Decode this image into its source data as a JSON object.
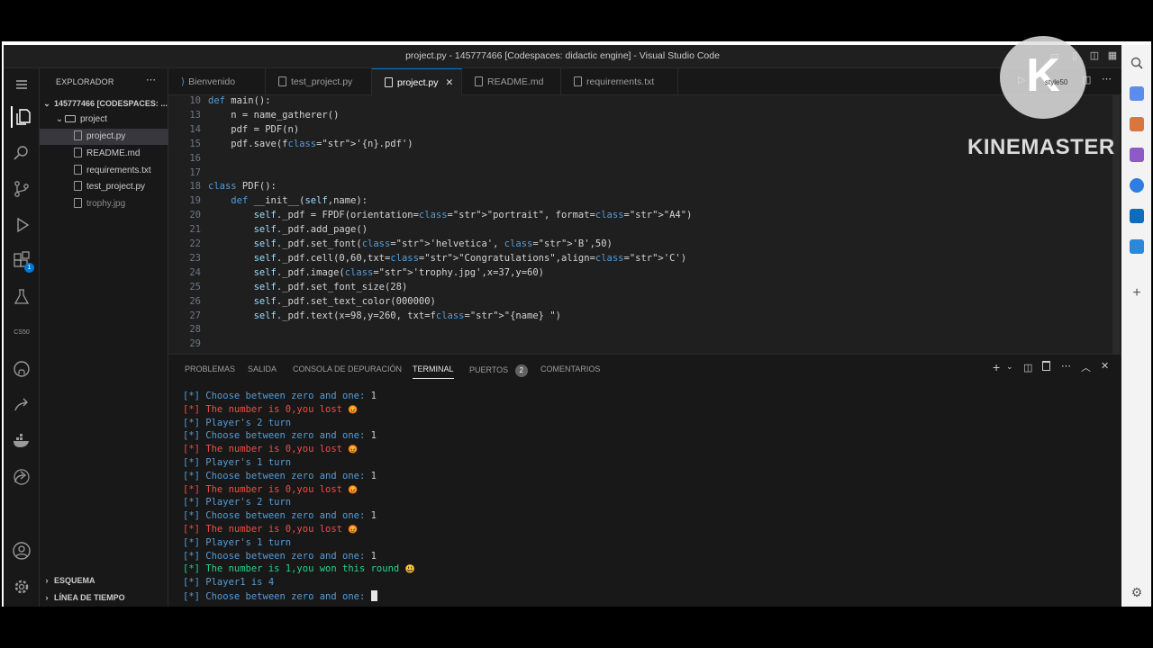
{
  "window": {
    "title": "project.py - 145777466 [Codespaces: didactic engine] - Visual Studio Code"
  },
  "sidebar": {
    "header": "EXPLORADOR",
    "root": "145777466 [CODESPACES: ...",
    "folder": "project",
    "files": [
      "project.py",
      "README.md",
      "requirements.txt",
      "test_project.py",
      "trophy.jpg"
    ],
    "outline": "ESQUEMA",
    "timeline": "LÍNEA DE TIEMPO"
  },
  "tabs": [
    "Bienvenido",
    "test_project.py",
    "project.py",
    "README.md",
    "requirements.txt"
  ],
  "activity": {
    "badge": "1",
    "cs50": "CS50"
  },
  "editor": {
    "lines": [
      {
        "n": "10",
        "t": "def main():"
      },
      {
        "n": "13",
        "t": "    n = name_gatherer()"
      },
      {
        "n": "14",
        "t": "    pdf = PDF(n)"
      },
      {
        "n": "15",
        "t": "    pdf.save(f'{n}.pdf')"
      },
      {
        "n": "16",
        "t": ""
      },
      {
        "n": "17",
        "t": ""
      },
      {
        "n": "18",
        "t": "class PDF():"
      },
      {
        "n": "19",
        "t": "    def __init__(self,name):"
      },
      {
        "n": "20",
        "t": "        self._pdf = FPDF(orientation=\"portrait\", format=\"A4\")"
      },
      {
        "n": "21",
        "t": "        self._pdf.add_page()"
      },
      {
        "n": "22",
        "t": "        self._pdf.set_font('helvetica', 'B',50)"
      },
      {
        "n": "23",
        "t": "        self._pdf.cell(0,60,txt=\"Congratulations\",align='C')"
      },
      {
        "n": "24",
        "t": "        self._pdf.image('trophy.jpg',x=37,y=60)"
      },
      {
        "n": "25",
        "t": "        self._pdf.set_font_size(28)"
      },
      {
        "n": "26",
        "t": "        self._pdf.set_text_color(000000)"
      },
      {
        "n": "27",
        "t": "        self._pdf.text(x=98,y=260, txt=f\"{name} \")"
      },
      {
        "n": "28",
        "t": ""
      },
      {
        "n": "29",
        "t": ""
      }
    ]
  },
  "panel": {
    "tabs": [
      "PROBLEMAS",
      "SALIDA",
      "CONSOLA DE DEPURACIÓN",
      "TERMINAL",
      "PUERTOS",
      "COMENTARIOS"
    ],
    "ports_count": "2",
    "terminal": [
      {
        "c": "blue",
        "t": "[*] Choose between zero and one: ",
        "v": "1"
      },
      {
        "c": "red",
        "t": "[*] The number is 0,you lost ",
        "e": "😡"
      },
      {
        "c": "blue",
        "t": "[*] Player's 2 turn"
      },
      {
        "c": "blue",
        "t": "[*] Choose between zero and one: ",
        "v": "1"
      },
      {
        "c": "red",
        "t": "[*] The number is 0,you lost ",
        "e": "😡"
      },
      {
        "c": "blue",
        "t": "[*] Player's 1 turn"
      },
      {
        "c": "blue",
        "t": "[*] Choose between zero and one: ",
        "v": "1"
      },
      {
        "c": "red",
        "t": "[*] The number is 0,you lost ",
        "e": "😡"
      },
      {
        "c": "blue",
        "t": "[*] Player's 2 turn"
      },
      {
        "c": "blue",
        "t": "[*] Choose between zero and one: ",
        "v": "1"
      },
      {
        "c": "red",
        "t": "[*] The number is 0,you lost ",
        "e": "😡"
      },
      {
        "c": "blue",
        "t": "[*] Player's 1 turn"
      },
      {
        "c": "blue",
        "t": "[*] Choose between zero and one: ",
        "v": "1"
      },
      {
        "c": "green",
        "t": "[*] The number is 1,you won this round ",
        "e": "😃"
      },
      {
        "c": "blue",
        "t": "[*] Player1 is 4"
      },
      {
        "c": "blue",
        "t": "[*] Choose between zero and one: "
      }
    ]
  },
  "watermark": {
    "brand": "KINEMASTER",
    "logo_letter": "K",
    "overlay": "style50"
  }
}
